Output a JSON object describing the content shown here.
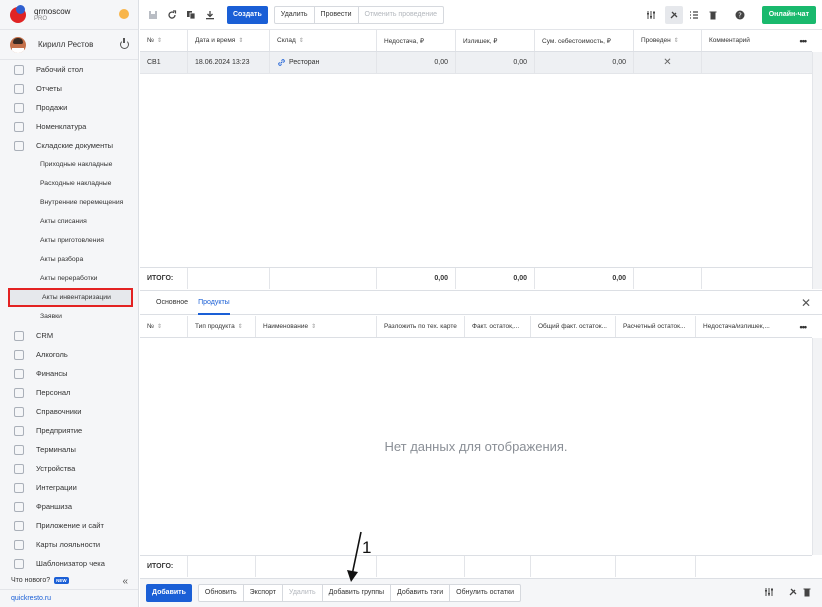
{
  "brand": {
    "name": "qrmoscow",
    "plan": "PRO"
  },
  "user": {
    "name": "Кирилл Рестов"
  },
  "nav": {
    "items": [
      {
        "label": "Рабочий стол",
        "icon": "dashboard-icon"
      },
      {
        "label": "Отчеты",
        "icon": "chart-icon"
      },
      {
        "label": "Продажи",
        "icon": "basket-icon"
      },
      {
        "label": "Номенклатура",
        "icon": "tag-icon"
      },
      {
        "label": "Складские документы",
        "icon": "box-icon"
      }
    ],
    "sub_items": [
      {
        "label": "Приходные накладные"
      },
      {
        "label": "Расходные накладные"
      },
      {
        "label": "Внутренние перемещения"
      },
      {
        "label": "Акты списания"
      },
      {
        "label": "Акты приготовления"
      },
      {
        "label": "Акты разбора"
      },
      {
        "label": "Акты переработки"
      },
      {
        "label": "Акты инвентаризации",
        "active": true
      },
      {
        "label": "Заявки"
      }
    ],
    "items2": [
      {
        "label": "CRM",
        "icon": "crm-icon"
      },
      {
        "label": "Алкоголь",
        "icon": "glass-icon"
      },
      {
        "label": "Финансы",
        "icon": "wallet-icon"
      },
      {
        "label": "Персонал",
        "icon": "person-icon"
      },
      {
        "label": "Справочники",
        "icon": "book-icon"
      },
      {
        "label": "Предприятие",
        "icon": "building-icon"
      },
      {
        "label": "Терминалы",
        "icon": "terminal-icon"
      },
      {
        "label": "Устройства",
        "icon": "printer-icon"
      },
      {
        "label": "Интеграции",
        "icon": "link-icon"
      },
      {
        "label": "Франшиза",
        "icon": "franchise-icon"
      },
      {
        "label": "Приложение и сайт",
        "icon": "app-icon"
      },
      {
        "label": "Карты лояльности",
        "icon": "card-icon"
      },
      {
        "label": "Шаблонизатор чека",
        "icon": "receipt-icon"
      }
    ],
    "whats_new": "Что нового?",
    "new_badge": "NEW",
    "site": "quickresto.ru"
  },
  "toolbar": {
    "create": "Создать",
    "delete": "Удалить",
    "post": "Провести",
    "unpost": "Отменить проведение",
    "chat": "Онлайн-чат"
  },
  "grid": {
    "columns": [
      "№",
      "Дата и время",
      "Склад",
      "Недостача, ₽",
      "Излишек, ₽",
      "Сум. себестоимость, ₽",
      "Проведен",
      "Комментарий"
    ],
    "rows": [
      {
        "num": "СВ1",
        "datetime": "18.06.2024 13:23",
        "warehouse": "Ресторан",
        "shortage": "0,00",
        "surplus": "0,00",
        "cost": "0,00",
        "posted": "✕",
        "comment": ""
      }
    ],
    "total_label": "ИТОГО:",
    "totals": {
      "shortage": "0,00",
      "surplus": "0,00",
      "cost": "0,00"
    }
  },
  "tabs": [
    {
      "label": "Основное"
    },
    {
      "label": "Продукты",
      "active": true
    }
  ],
  "products": {
    "columns": [
      "№",
      "Тип продукта",
      "Наименование",
      "Разложить по тех. карте",
      "Факт. остаток,...",
      "Общий факт. остаток...",
      "Расчетный остаток...",
      "Недостача/излишек,..."
    ],
    "empty": "Нет данных для отображения.",
    "total_label": "ИТОГО:"
  },
  "bottom": {
    "add": "Добавить",
    "refresh": "Обновить",
    "export": "Экспорт",
    "delete": "Удалить",
    "add_groups": "Добавить группы",
    "add_tags": "Добавить тэги",
    "reset": "Обнулить остатки"
  },
  "annotation": {
    "number": "1"
  },
  "colors": {
    "primary": "#1a5fd6",
    "chat": "#19b96d",
    "highlight": "#e32222"
  }
}
